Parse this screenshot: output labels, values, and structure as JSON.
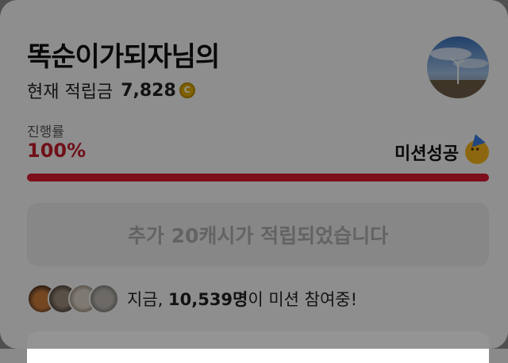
{
  "header": {
    "title": "똑순이가되자님의",
    "points_label": "현재 적립금",
    "points_value": "7,828",
    "coin_icon": "coin-icon",
    "avatar_icon": "profile-avatar"
  },
  "progress": {
    "label": "진행률",
    "value_text": "100%",
    "fraction": 1.0,
    "status_text": "미션성공",
    "status_icon": "party-face-icon",
    "fill_color": "#d8192f"
  },
  "notice": {
    "text": "추가 20캐시가 적립되었습니다"
  },
  "participants": {
    "prefix": "지금, ",
    "count": "10,539명",
    "suffix": "이 미션 참여중!",
    "avatar_icons": [
      "participant-avatar-1",
      "participant-avatar-2",
      "participant-avatar-3",
      "participant-avatar-4"
    ]
  },
  "colors": {
    "accent": "#c21e2b",
    "coin": "#d9a800"
  }
}
